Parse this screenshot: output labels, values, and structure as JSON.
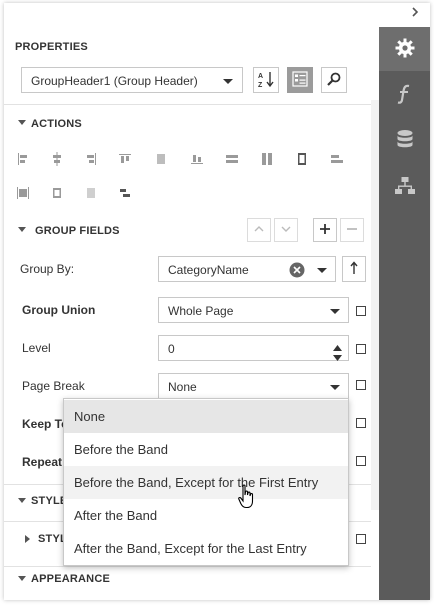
{
  "panel": {
    "heading": "PROPERTIES",
    "selector": {
      "value": "GroupHeader1 (Group Header)"
    },
    "toolbar": {
      "sort_alpha_icon": "sort-alphabetical-icon",
      "categorized_icon": "categorized-icon",
      "search_icon": "search-icon"
    }
  },
  "sidetabs": [
    {
      "name": "properties-tab",
      "icon": "gear-icon",
      "active": true
    },
    {
      "name": "expressions-tab",
      "icon": "function-icon",
      "active": false
    },
    {
      "name": "field-list-tab",
      "icon": "database-icon",
      "active": false
    },
    {
      "name": "report-explorer-tab",
      "icon": "hierarchy-icon",
      "active": false
    }
  ],
  "sections": {
    "actions": "ACTIONS",
    "group_fields": "GROUP FIELDS",
    "styles": "STYLES",
    "styles_sub": "STYLES",
    "appearance": "APPEARANCE"
  },
  "fields": {
    "group_by": {
      "label": "Group By:",
      "value": "CategoryName"
    },
    "group_union": {
      "label": "Group Union",
      "value": "Whole Page"
    },
    "level": {
      "label": "Level",
      "value": "0"
    },
    "page_break": {
      "label": "Page Break",
      "value": "None"
    },
    "keep_together": {
      "label": "Keep To"
    },
    "repeat_every_page": {
      "label": "Repeat E"
    }
  },
  "dropdown": {
    "options": [
      "None",
      "Before the Band",
      "Before the Band, Except for the First Entry",
      "After the Band",
      "After the Band, Except for the Last Entry"
    ],
    "selected_index": 0,
    "hover_index": 2
  },
  "colors": {
    "sidebar": "#5b5b5b",
    "sidebar_active": "#6e6e6e",
    "toggle_active": "#9b9b9b"
  }
}
